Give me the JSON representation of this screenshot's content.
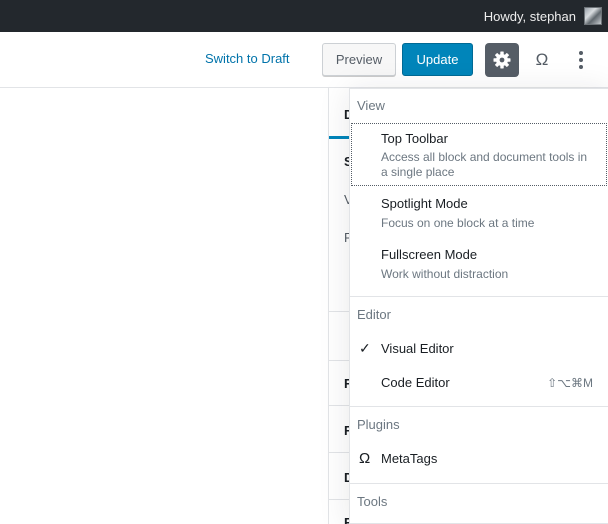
{
  "admin_bar": {
    "greeting": "Howdy, stephan"
  },
  "header": {
    "switch_to_draft": "Switch to Draft",
    "preview": "Preview",
    "update": "Update",
    "omega_symbol": "Ω",
    "settings_icon": "gear-icon",
    "more_icon": "vertical-ellipsis-icon"
  },
  "sidebar": {
    "tab_initial": "D",
    "letters": [
      "S",
      "V",
      "P",
      "F",
      "F",
      "D",
      "F"
    ]
  },
  "menu": {
    "view": {
      "title": "View",
      "items": [
        {
          "label": "Top Toolbar",
          "description": "Access all block and document tools in a single place"
        },
        {
          "label": "Spotlight Mode",
          "description": "Focus on one block at a time"
        },
        {
          "label": "Fullscreen Mode",
          "description": "Work without distraction"
        }
      ]
    },
    "editor": {
      "title": "Editor",
      "items": [
        {
          "label": "Visual Editor",
          "checked": true,
          "check_glyph": "✓"
        },
        {
          "label": "Code Editor",
          "shortcut": "⇧⌥⌘M"
        }
      ]
    },
    "plugins": {
      "title": "Plugins",
      "items": [
        {
          "label": "MetaTags",
          "icon_glyph": "Ω"
        }
      ]
    },
    "tools": {
      "title": "Tools"
    }
  },
  "colors": {
    "admin_bar": "#23282d",
    "primary": "#0085ba",
    "link": "#0073aa",
    "settings_active": "#555d66"
  }
}
